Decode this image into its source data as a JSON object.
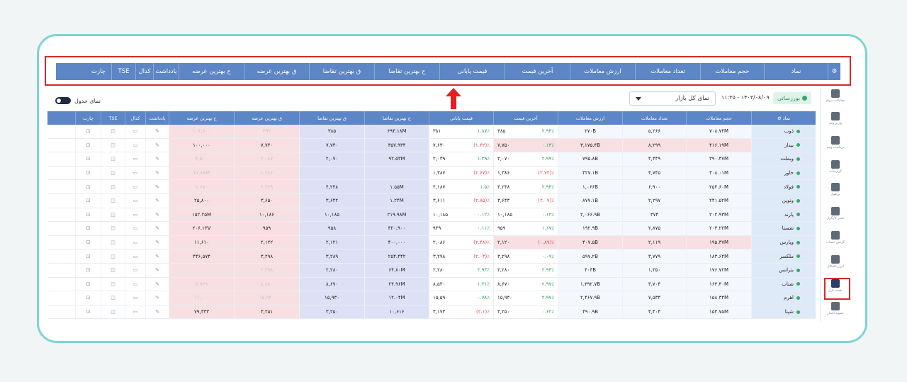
{
  "table_toggle": {
    "label": "نمای جدول"
  },
  "market_view": {
    "value": "نمای کل بازار"
  },
  "datetime": "۱۱:۳۵ - ۱۴۰۳/۰۸/۰۹",
  "market_status": "بورزساتی",
  "columns": [
    "نماد",
    "حجم معاملات",
    "تعداد معاملات",
    "ارزش معاملات",
    "آخرین قیمت",
    "قیمت پایانی",
    "ح بهترین تقاضا",
    "ق بهترین تقاضا",
    "ق بهترین عرضه",
    "ح بهترین عرضه",
    "یادداشت",
    "کدال",
    "TSE",
    "چارت"
  ],
  "sidebar": [
    {
      "label": "معاملات سهام",
      "icon": "home-icon"
    },
    {
      "label": "واریز وجه",
      "icon": "deposit-icon"
    },
    {
      "label": "برداشت وجه",
      "icon": "withdraw-icon"
    },
    {
      "label": "گزارشات",
      "icon": "reports-icon"
    },
    {
      "label": "پرتفوی",
      "icon": "portfolio-icon"
    },
    {
      "label": "تغییر کارگزار",
      "icon": "shuffle-icon"
    },
    {
      "label": "گردش حساب",
      "icon": "account-icon"
    },
    {
      "label": "ابزار تکنیکال",
      "icon": "chart-icon"
    },
    {
      "label": "نقشه بازار",
      "icon": "market-map-icon"
    },
    {
      "label": "تسویه اختیار",
      "icon": "settle-icon"
    }
  ],
  "rows": [
    {
      "symbol": "ذوب",
      "volume": "۷۰۸.۷۴M",
      "count": "۵,۲۶۶",
      "value": "۲۷۰B",
      "last": "۳۸۵",
      "last_pct": "۲.۹۴٪",
      "final": "۳۸۱",
      "final_pct": "۱.۸۷٪",
      "bid_vol": "۶۹۴.۱۸M",
      "bid_price": "۳۸۵",
      "ask_price": "۳۹۶",
      "ask_vol": "۱۰۴,۶۰۰"
    },
    {
      "symbol": "بیدار",
      "volume": "۴۱۶.۱۹M",
      "count": "۸,۲۹۹",
      "value": "۳,۱۷۵.۴B",
      "last": "۷,۷۵۰",
      "last_pct": "۰.۱۳٪",
      "final": "۷,۶۳۰",
      "final_pct": "(۱.۴۲)٪",
      "bid_vol": "۳۵۷.۹۳۴",
      "bid_price": "۷,۷۴۰",
      "ask_price": "۷,۷۴۰",
      "ask_vol": "۱۰۰,۰۰۰"
    },
    {
      "symbol": "وبملت",
      "volume": "۳۹۰.۴۷M",
      "count": "۴,۴۴۹",
      "value": "۷۹۵.۸B",
      "last": "۲,۰۷۰",
      "last_pct": "۲.۹۹٪",
      "final": "۲,۰۳۹",
      "final_pct": "۱.۳۹٪",
      "bid_vol": "۹۲.۵۳M",
      "bid_price": "۲,۰۷۰",
      "ask_price": "۲,۰۸۷",
      "ask_vol": "۲,۵۰۰"
    },
    {
      "symbol": "خاور",
      "volume": "۳۰۸.۰۱M",
      "count": "۴,۷۴۵",
      "value": "۴۲۷.۱B",
      "last": "۱,۳۸۶",
      "last_pct": "(۲.۷۴)٪",
      "final": "۱,۳۸۷",
      "final_pct": "(۲.۶۷)٪",
      "bid_vol": "۰",
      "bid_price": "۰",
      "ask_price": "۱,۳۸۶",
      "ask_vol": "۷۱.۸۸M"
    },
    {
      "symbol": "فولاد",
      "volume": "۲۵۴.۶۰M",
      "count": "۶,۹۰۰",
      "value": "۱,۰۶۶B",
      "last": "۴,۲۴۸",
      "last_pct": "۲.۹۴٪",
      "final": "۴,۱۸۷",
      "final_pct": "۱.۵٪",
      "bid_vol": "۱.۵۵M",
      "bid_price": "۴,۲۴۸",
      "ask_price": "۴,۲۶۹",
      "ask_vol": "۱,۶۵۰"
    },
    {
      "symbol": "ونوین",
      "volume": "۲۴۱.۵۲M",
      "count": "۲,۲۹۷",
      "value": "۸۷۷.۱B",
      "last": "۳,۶۴۳",
      "last_pct": "(۲.۰۷)٪",
      "final": "۳,۶۱۱",
      "final_pct": "(۲.۸۵)٪",
      "bid_vol": "۱.۲۴M",
      "bid_price": "۳,۶۴۲",
      "ask_price": "۳,۶۵۰",
      "ask_vol": "۲۵,۸۰۰"
    },
    {
      "symbol": "پارند",
      "volume": "۲۰۲.۹۳M",
      "count": "۳۷۴",
      "value": "۲,۰۶۶.۹B",
      "last": "۱۰,۱۸۵",
      "last_pct": "۰.۱۲٪",
      "final": "۱۰,۱۸۵",
      "final_pct": "۰.۱۲٪",
      "bid_vol": "۲۱۹.۹۸M",
      "bid_price": "۱۰,۱۸۵",
      "ask_price": "۱۰,۱۸۶",
      "ask_vol": "۱۵۲.۲۵M"
    },
    {
      "symbol": "شستا",
      "volume": "۲۰۳.۲۲M",
      "count": "۲,۸۷۵",
      "value": "۱۹۲.۹B",
      "last": "۹۵۹",
      "last_pct": "۱.۱۷٪",
      "final": "۹۴۹",
      "final_pct": "۰.۱۱٪",
      "bid_vol": "۴۲۰,۹۰۰",
      "bid_price": "۹۵۸",
      "ask_price": "۹۵۹",
      "ask_vol": "۲۰۶.۱۳V"
    },
    {
      "symbol": "وپارس",
      "volume": "۱۹۵.۳۷M",
      "count": "۲,۱۱۹",
      "value": "۴۰۷.۵B",
      "last": "۲,۱۲۰",
      "last_pct": "(۰.۸۹)٪",
      "final": "۲,۰۸۶",
      "final_pct": "(۲.۴۸)٪",
      "bid_vol": "۴۰۰,۰۰۰",
      "bid_price": "۲,۱۲۱",
      "ask_price": "۲,۱۲۲",
      "ask_vol": "۱۱,۶۱۰"
    },
    {
      "symbol": "ملکسر",
      "volume": "۱۸۳.۶۴M",
      "count": "۳,۷۷۹",
      "value": "۵۹۷.۲B",
      "last": "۳,۲۹۸",
      "last_pct": "۰.۰۹٪",
      "final": "۳,۲۷۸",
      "final_pct": "(۲.۰۳)٪",
      "bid_vol": "۲۵۴.۴۴۲",
      "bid_price": "۳,۲۸۹",
      "ask_price": "۳,۲۹۸",
      "ask_vol": "۴۴۶,۵۷۴"
    },
    {
      "symbol": "بترانس",
      "volume": "۱۷۶.۷۲M",
      "count": "۱,۳۵۰",
      "value": "۴۰۳B",
      "last": "۲,۲۸۰",
      "last_pct": "۲.۹۳٪",
      "final": "۲,۲۸۰",
      "final_pct": "۲.۹۴٪",
      "bid_vol": "۶۴.۸۰M",
      "bid_price": "۲,۲۸۰",
      "ask_price": "۲,۳۹۸",
      "ask_vol": "۰"
    },
    {
      "symbol": "شتاب",
      "volume": "۱۶۳.۴۰M",
      "count": "۳,۷۰۴",
      "value": "۱,۳۹۲.۷B",
      "last": "۸,۶۷۰",
      "last_pct": "۲.۹۷٪",
      "final": "۸,۵۳۰",
      "final_pct": "۱.۳۱٪",
      "bid_vol": "۲۴.۹۶M",
      "bid_price": "۸,۶۷۰",
      "ask_price": "۸,۸۸۰",
      "ask_vol": "۲,۷۶۹"
    },
    {
      "symbol": "اهرم",
      "volume": "۱۵۸.۳۴M",
      "count": "۷,۵۳۴",
      "value": "۲,۴۶۷.۹B",
      "last": "۱۵,۹۳۰",
      "last_pct": "۲.۹۷٪",
      "final": "۱۵,۵۹۰",
      "final_pct": "۰.۷۸٪",
      "bid_vol": "۱۲.۰۴M",
      "bid_price": "۱۵,۹۳۰",
      "ask_price": "۱۵,۹۳۰",
      "ask_vol": "۱۱,۰۰۰"
    },
    {
      "symbol": "شپنا",
      "volume": "۱۵۴.۷۵M",
      "count": "۴,۴۰۴",
      "value": "۴۹۰.۹B",
      "last": "۳,۲۵۰",
      "last_pct": "۰.۶۲٪",
      "final": "۳,۱۷۳",
      "final_pct": "(۲.۱)٪",
      "bid_vol": "۱۰,۶۱۶",
      "bid_price": "۳,۲۵۰",
      "ask_price": "۳,۲۵۱",
      "ask_vol": "۷۹,۳۳۳"
    }
  ],
  "colors": {
    "header": "#5c86c6",
    "accent_frame": "#7fd3d3",
    "highlight": "#d42a2a",
    "positive": "#2c9a5f",
    "negative": "#d24c58"
  }
}
